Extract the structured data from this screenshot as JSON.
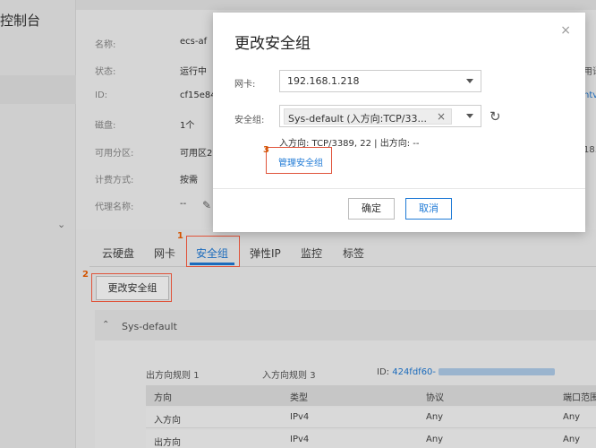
{
  "sidebar": {
    "title": "控制台"
  },
  "detail": {
    "rows": [
      {
        "label": "名称:",
        "value": "ecs-af"
      },
      {
        "label": "状态:",
        "value": "运行中"
      },
      {
        "label": "ID:",
        "value": "cf15e84"
      },
      {
        "label": "磁盘:",
        "value": "1个"
      },
      {
        "label": "可用分区:",
        "value": "可用区2"
      },
      {
        "label": "计费方式:",
        "value": "按需"
      },
      {
        "label": "代理名称:",
        "value": "--"
      }
    ],
    "edge_texts": [
      "用语",
      "ntv",
      "18."
    ]
  },
  "tabs": [
    "云硬盘",
    "网卡",
    "安全组",
    "弹性IP",
    "监控",
    "标签"
  ],
  "active_tab": "安全组",
  "change_button": "更改安全组",
  "security_group": {
    "name": "Sys-default",
    "outbound_label": "出方向规则",
    "outbound_count": "1",
    "inbound_label": "入方向规则",
    "inbound_count": "3",
    "id_label": "ID:",
    "id_value": "424fdf60-",
    "table": {
      "headers": [
        "方向",
        "类型",
        "协议",
        "端口范围"
      ],
      "rows": [
        [
          "入方向",
          "IPv4",
          "Any",
          "Any"
        ],
        [
          "出方向",
          "IPv4",
          "Any",
          "Any"
        ]
      ]
    }
  },
  "modal": {
    "title": "更改安全组",
    "close_icon": "×",
    "nic_label": "网卡:",
    "nic_value": "192.168.1.218",
    "sg_label": "安全组:",
    "sg_tag": "Sys-default (入方向:TCP/33...",
    "sg_tag_remove": "×",
    "rules_text": "入方向: TCP/3389, 22 | 出方向: --",
    "manage_link": "管理安全组",
    "ok_button": "确定",
    "cancel_button": "取消"
  },
  "steps": {
    "tab": "1",
    "button": "2",
    "link": "3"
  },
  "colors": {
    "accent": "#1f7ad6",
    "annotation": "#e0533a"
  }
}
